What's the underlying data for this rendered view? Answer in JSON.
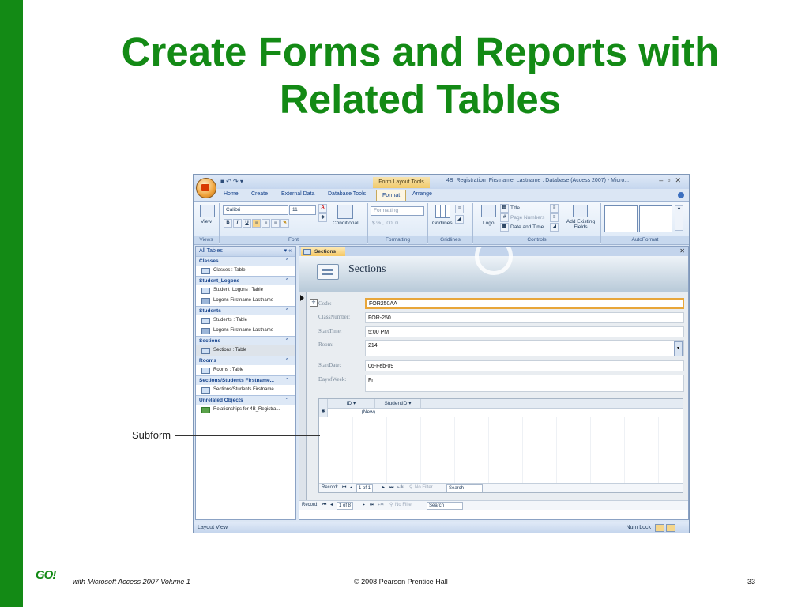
{
  "slide": {
    "title_line1": "Create Forms and Reports with",
    "title_line2": "Related Tables",
    "callout": "Subform",
    "footer_logo": "GO!",
    "footer_sub": "with Microsoft Access 2007 Volume 1",
    "footer_copy": "© 2008 Pearson Prentice Hall",
    "page_number": "33"
  },
  "window": {
    "context_tab": "Form Layout Tools",
    "title": "4B_Registration_Firstname_Lastname : Database (Access 2007) - Micro...",
    "tabs": [
      "Home",
      "Create",
      "External Data",
      "Database Tools",
      "Format",
      "Arrange"
    ],
    "selected_tab": "Format"
  },
  "ribbon": {
    "view_label": "View",
    "font_name": "Calibri",
    "font_size": "11",
    "conditional_label": "Conditional",
    "formatting_box": "Formatting",
    "number_buttons": "$  %  ,  .00 .0",
    "gridlines_label": "Gridlines",
    "logo_label": "Logo",
    "title_label": "Title",
    "page_numbers_label": "Page Numbers",
    "date_time_label": "Date and Time",
    "add_existing_fields_label": "Add Existing Fields",
    "groups": [
      "Views",
      "Font",
      "Formatting",
      "Gridlines",
      "Controls",
      "AutoFormat"
    ]
  },
  "nav_pane": {
    "header": "All Tables",
    "groups": [
      {
        "name": "Classes",
        "items": [
          {
            "label": "Classes : Table",
            "kind": "table"
          }
        ]
      },
      {
        "name": "Student_Logons",
        "items": [
          {
            "label": "Student_Logons : Table",
            "kind": "table"
          },
          {
            "label": "Logons Firstname Lastname",
            "kind": "form"
          }
        ]
      },
      {
        "name": "Students",
        "items": [
          {
            "label": "Students : Table",
            "kind": "table"
          },
          {
            "label": "Logons Firstname Lastname",
            "kind": "form"
          }
        ]
      },
      {
        "name": "Sections",
        "items": [
          {
            "label": "Sections : Table",
            "kind": "table",
            "selected": true
          }
        ]
      },
      {
        "name": "Rooms",
        "items": [
          {
            "label": "Rooms : Table",
            "kind": "table"
          }
        ]
      },
      {
        "name": "Sections/Students Firstname...",
        "items": [
          {
            "label": "Sections/Students Firstname ...",
            "kind": "table"
          }
        ]
      },
      {
        "name": "Unrelated Objects",
        "items": [
          {
            "label": "Relationships for 4B_Registra...",
            "kind": "relationship"
          }
        ]
      }
    ]
  },
  "form": {
    "tab_label": "Sections",
    "header_title": "Sections",
    "fields": [
      {
        "label": "Code:",
        "value": "FOR250AA"
      },
      {
        "label": "ClassNumber:",
        "value": "FOR-250"
      },
      {
        "label": "StartTime:",
        "value": "5:00 PM"
      },
      {
        "label": "Room:",
        "value": "214"
      },
      {
        "label": "StartDate:",
        "value": "06-Feb-09"
      },
      {
        "label": "DayofWeek:",
        "value": "Fri"
      }
    ],
    "subform": {
      "columns": [
        "ID",
        "StudentID"
      ],
      "new_row": "(New)",
      "record_label": "Record:",
      "record_pos": "1 of 1",
      "no_filter": "No Filter",
      "search": "Search"
    },
    "main_nav": {
      "record_label": "Record:",
      "record_pos": "1 of 8",
      "no_filter": "No Filter",
      "search": "Search"
    }
  },
  "status_bar": {
    "left": "Layout View",
    "right": "Num Lock"
  },
  "colors": {
    "brand_green": "#138a15",
    "active_field_border": "#e8a63a"
  }
}
